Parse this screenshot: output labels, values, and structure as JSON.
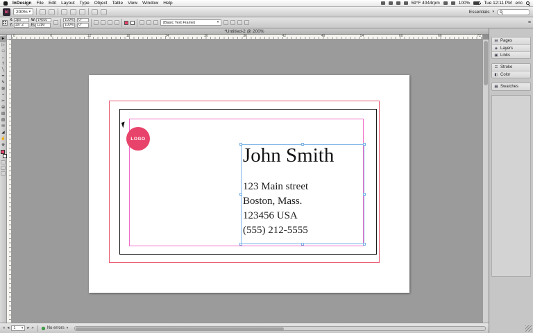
{
  "menubar": {
    "app_name": "InDesign",
    "menus": [
      "File",
      "Edit",
      "Layout",
      "Type",
      "Object",
      "Table",
      "View",
      "Window",
      "Help"
    ],
    "status_text": "59°F 4044rpm",
    "battery_pct": "100%",
    "clock": "Tue 12:11 PM",
    "user": "eric"
  },
  "appbar": {
    "logo": "Id",
    "zoom_value": "200%",
    "workspace": "Essentials"
  },
  "controlbar": {
    "x_label": "X:",
    "x_value": "3p0",
    "y_label": "Y:",
    "y_value": "1p7.2",
    "w_label": "W:",
    "w_value": "14p10",
    "h_label": "H:",
    "h_value": "12p0",
    "scale_x": "100%",
    "scale_y": "100%",
    "rotate": "0°",
    "shear": "0°",
    "frame_style": "[Basic Text Frame]"
  },
  "tab": {
    "title": "*Untitled-2 @ 200%"
  },
  "rulers": {
    "h_ticks": [
      "0",
      "6",
      "12",
      "18",
      "24",
      "30",
      "36",
      "42",
      "48",
      "54",
      "60",
      "66",
      "72"
    ]
  },
  "tools": [
    {
      "name": "selection-tool",
      "glyph": "►"
    },
    {
      "name": "direct-selection-tool",
      "glyph": "▷"
    },
    {
      "name": "page-tool",
      "glyph": "□"
    },
    {
      "name": "gap-tool",
      "glyph": "↔"
    },
    {
      "name": "type-tool",
      "glyph": "T"
    },
    {
      "name": "line-tool",
      "glyph": "╲"
    },
    {
      "name": "pen-tool",
      "glyph": "✒"
    },
    {
      "name": "pencil-tool",
      "glyph": "✎"
    },
    {
      "name": "rectangle-frame-tool",
      "glyph": "⊠"
    },
    {
      "name": "rectangle-tool",
      "glyph": "▪"
    },
    {
      "name": "scissors-tool",
      "glyph": "✂"
    },
    {
      "name": "free-transform-tool",
      "glyph": "⊞"
    },
    {
      "name": "gradient-tool",
      "glyph": "▧"
    },
    {
      "name": "gradient-feather-tool",
      "glyph": "▨"
    },
    {
      "name": "note-tool",
      "glyph": "✉"
    },
    {
      "name": "eyedropper-tool",
      "glyph": "◢"
    },
    {
      "name": "hand-tool",
      "glyph": "☝"
    },
    {
      "name": "zoom-tool",
      "glyph": "⊕"
    }
  ],
  "document": {
    "logo_label": "LOGO",
    "name": "John Smith",
    "address": [
      "123 Main street",
      "Boston, Mass.",
      "123456 USA",
      "(555) 212-5555"
    ]
  },
  "dock": {
    "panels": [
      {
        "label": "Pages",
        "icon": "▤"
      },
      {
        "label": "Layers",
        "icon": "◈"
      },
      {
        "label": "Links",
        "icon": "▣"
      },
      {
        "label": "Stroke",
        "icon": "☰"
      },
      {
        "label": "Color",
        "icon": "◧"
      },
      {
        "label": "Swatches",
        "icon": "▦"
      }
    ]
  },
  "statusbar": {
    "page_number": "1",
    "preflight": "No errors"
  },
  "icons": {
    "chevron_down": "▾",
    "nav_first": "«",
    "nav_prev": "◂",
    "nav_next": "▸",
    "nav_last": "»",
    "panel_menu": "≡"
  },
  "colors": {
    "bleed_guide": "#ea5b72",
    "margin_guide": "#f06bc8",
    "selection_frame": "#7ab2e6",
    "logo_bg": "#e8436a",
    "preflight_ok": "#3fae49"
  }
}
